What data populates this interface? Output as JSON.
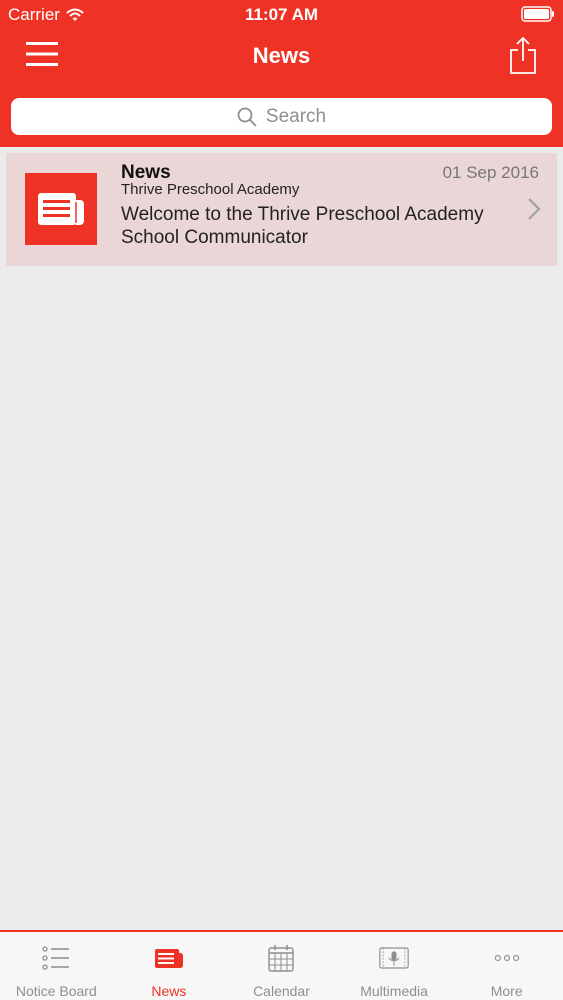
{
  "status_bar": {
    "carrier": "Carrier",
    "time": "11:07 AM"
  },
  "header": {
    "title": "News"
  },
  "search": {
    "placeholder": "Search"
  },
  "news_items": [
    {
      "title": "News",
      "date": "01 Sep 2016",
      "organization": "Thrive Preschool Academy",
      "body": "Welcome to the Thrive Preschool Academy School Communicator"
    }
  ],
  "tabs": [
    {
      "label": "Notice Board",
      "icon": "notice-board-icon",
      "active": false
    },
    {
      "label": "News",
      "icon": "news-icon",
      "active": true
    },
    {
      "label": "Calendar",
      "icon": "calendar-icon",
      "active": false
    },
    {
      "label": "Multimedia",
      "icon": "multimedia-icon",
      "active": false
    },
    {
      "label": "More",
      "icon": "more-icon",
      "active": false
    }
  ],
  "colors": {
    "accent": "#ef3226",
    "row_background": "#ead6d6",
    "inactive_tab": "#8e8e93"
  }
}
